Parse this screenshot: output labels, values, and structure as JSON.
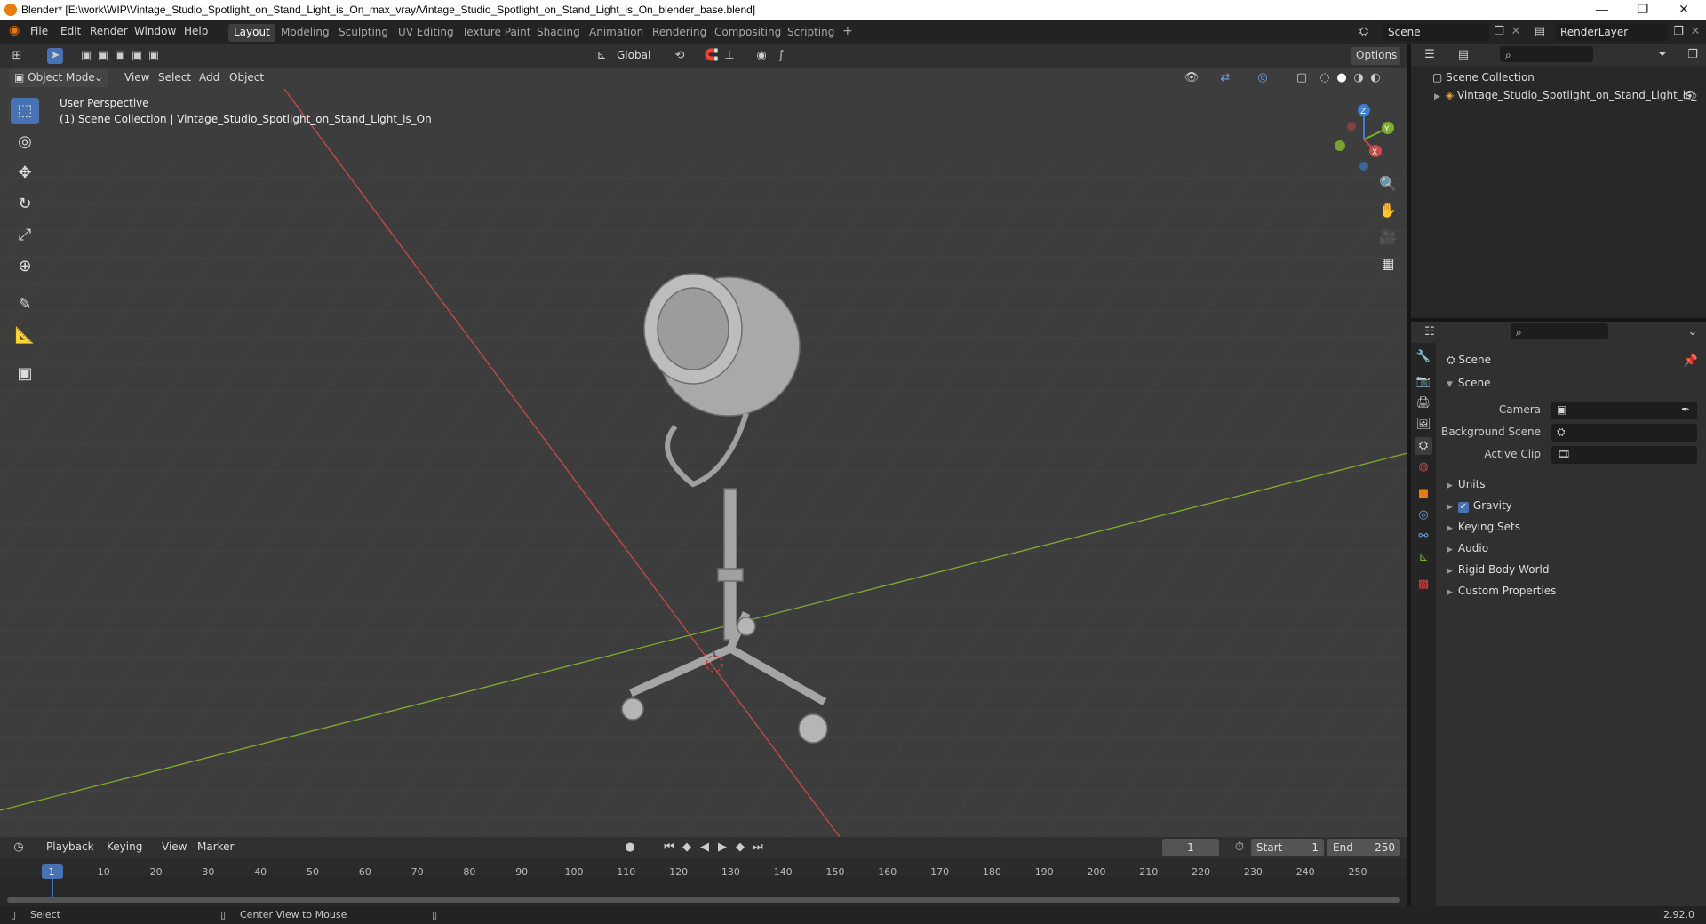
{
  "window": {
    "title": "Blender* [E:\\work\\WIP\\Vintage_Studio_Spotlight_on_Stand_Light_is_On_max_vray/Vintage_Studio_Spotlight_on_Stand_Light_is_On_blender_base.blend]",
    "minimize": "—",
    "restore": "❐",
    "close": "✕"
  },
  "menubar": {
    "items": [
      "File",
      "Edit",
      "Render",
      "Window",
      "Help"
    ],
    "workspaces": [
      "Layout",
      "Modeling",
      "Sculpting",
      "UV Editing",
      "Texture Paint",
      "Shading",
      "Animation",
      "Rendering",
      "Compositing",
      "Scripting"
    ],
    "active_workspace": "Layout",
    "add_workspace": "+",
    "scene": "Scene",
    "render_layer": "RenderLayer"
  },
  "viewport_header": {
    "mode": "Object Mode",
    "menus": [
      "View",
      "Select",
      "Add",
      "Object"
    ],
    "orientation": "Global",
    "options": "Options"
  },
  "viewport": {
    "perspective": "User Perspective",
    "collection_path": "(1) Scene Collection | Vintage_Studio_Spotlight_on_Stand_Light_is_On",
    "gizmo_axes": [
      "Z",
      "Y",
      "X"
    ]
  },
  "outliner": {
    "root": "Scene Collection",
    "items": [
      "Vintage_Studio_Spotlight_on_Stand_Light_is_"
    ]
  },
  "properties": {
    "context": "Scene",
    "section": "Scene",
    "fields": [
      {
        "label": "Camera",
        "value": ""
      },
      {
        "label": "Background Scene",
        "value": ""
      },
      {
        "label": "Active Clip",
        "value": ""
      }
    ],
    "panels": [
      "Units",
      "Gravity",
      "Keying Sets",
      "Audio",
      "Rigid Body World",
      "Custom Properties"
    ],
    "gravity_checked": true
  },
  "timeline": {
    "menus": [
      "Playback",
      "Keying",
      "View",
      "Marker"
    ],
    "current_frame": "1",
    "start_label": "Start",
    "start": "1",
    "end_label": "End",
    "end": "250",
    "ticks": [
      "1",
      "10",
      "20",
      "30",
      "40",
      "50",
      "60",
      "70",
      "80",
      "90",
      "100",
      "110",
      "120",
      "130",
      "140",
      "150",
      "160",
      "170",
      "180",
      "190",
      "200",
      "210",
      "220",
      "230",
      "240",
      "250"
    ]
  },
  "statusbar": {
    "left": "Select",
    "middle": "Center View to Mouse",
    "version": "2.92.0"
  },
  "colors": {
    "accent": "#4772b3",
    "x_axis": "#c94a4a",
    "y_axis": "#7fae2e",
    "z_axis": "#3d7ed6",
    "viewport_bg": "#3d3d3d"
  }
}
